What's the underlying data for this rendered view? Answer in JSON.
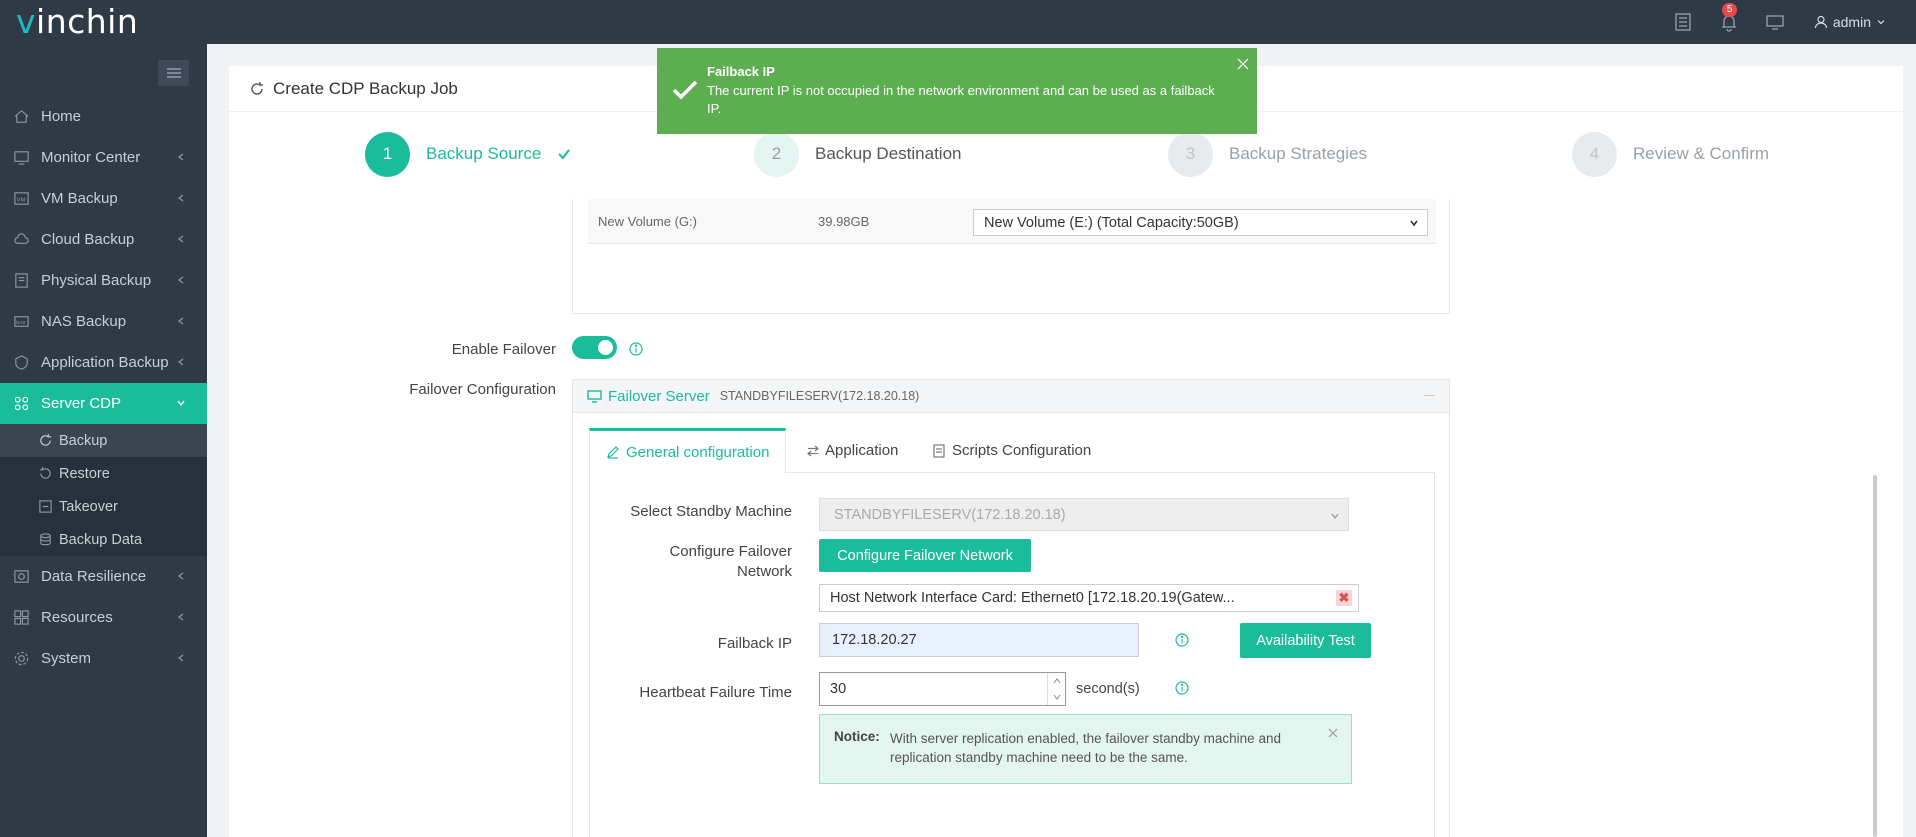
{
  "app": {
    "logo_prefix": "v",
    "logo_rest": "inchin"
  },
  "topbar": {
    "notification_count": "5",
    "user": "admin"
  },
  "sidebar": {
    "items": [
      {
        "label": "Home",
        "icon": "home-icon"
      },
      {
        "label": "Monitor Center",
        "icon": "monitor-icon"
      },
      {
        "label": "VM Backup",
        "icon": "vm-icon"
      },
      {
        "label": "Cloud Backup",
        "icon": "cloud-icon"
      },
      {
        "label": "Physical Backup",
        "icon": "server-icon"
      },
      {
        "label": "NAS Backup",
        "icon": "nas-icon"
      },
      {
        "label": "Application Backup",
        "icon": "app-icon"
      },
      {
        "label": "Server CDP",
        "icon": "cdp-icon"
      },
      {
        "label": "Data Resilience",
        "icon": "resilience-icon"
      },
      {
        "label": "Resources",
        "icon": "resources-icon"
      },
      {
        "label": "System",
        "icon": "system-icon"
      }
    ],
    "sub_items": [
      {
        "label": "Backup"
      },
      {
        "label": "Restore"
      },
      {
        "label": "Takeover"
      },
      {
        "label": "Backup Data"
      }
    ]
  },
  "page": {
    "title": "Create CDP Backup Job"
  },
  "steps": [
    {
      "num": "1",
      "label": "Backup Source",
      "state": "done"
    },
    {
      "num": "2",
      "label": "Backup Destination",
      "state": "current"
    },
    {
      "num": "3",
      "label": "Backup Strategies",
      "state": "pending"
    },
    {
      "num": "4",
      "label": "Review & Confirm",
      "state": "pending"
    }
  ],
  "volume": {
    "name": "New Volume (G:)",
    "size": "39.98GB",
    "target": "New Volume (E:) (Total Capacity:50GB)"
  },
  "form": {
    "enable_failover_label": "Enable Failover",
    "enable_failover": true,
    "failover_config_label": "Failover Configuration"
  },
  "failover": {
    "title": "Failover Server",
    "server": "STANDBYFILESERV(172.18.20.18)",
    "tabs": [
      "General configuration",
      "Application",
      "Scripts Configuration"
    ],
    "active_tab": "General configuration",
    "standby_label": "Select Standby Machine",
    "standby_value": "STANDBYFILESERV(172.18.20.18)",
    "network_label_1": "Configure Failover",
    "network_label_2": "Network",
    "network_button": "Configure Failover Network",
    "nic": "Host Network Interface Card: Ethernet0 [172.18.20.19(Gatew...",
    "failback_label": "Failback IP",
    "failback_ip": "172.18.20.27",
    "availability_button": "Availability Test",
    "heartbeat_label": "Heartbeat Failure Time",
    "heartbeat_value": "30",
    "heartbeat_unit": "second(s)",
    "notice_title": "Notice:",
    "notice_text": "With server replication enabled, the failover standby machine and replication standby machine need to be the same."
  },
  "toast": {
    "title": "Failback IP",
    "message": "The current IP is not occupied in the network environment and can be used as a failback IP."
  },
  "colors": {
    "accent": "#1abc9c",
    "sidebar": "#2f3a47",
    "toast": "#5cae50"
  }
}
